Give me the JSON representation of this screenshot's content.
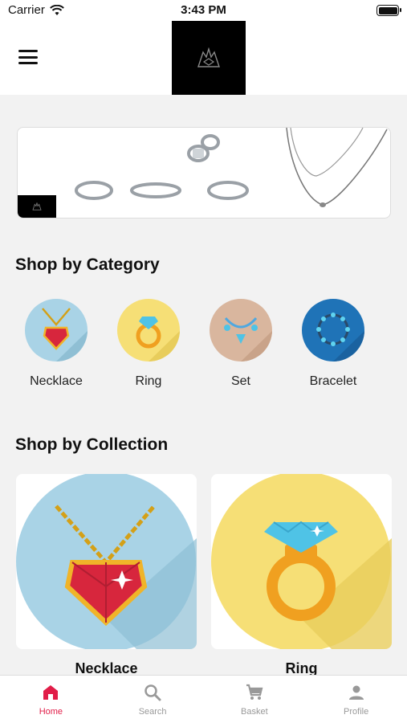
{
  "status": {
    "carrier": "Carrier",
    "time": "3:43 PM"
  },
  "sections": {
    "category_title": "Shop by Category",
    "collection_title": "Shop by Collection"
  },
  "categories": [
    {
      "label": "Necklace",
      "bg": "#a9d3e6"
    },
    {
      "label": "Ring",
      "bg": "#f6df76"
    },
    {
      "label": "Set",
      "bg": "#d9b69e"
    },
    {
      "label": "Bracelet",
      "bg": "#1f73b7"
    }
  ],
  "collections": [
    {
      "label": "Necklace"
    },
    {
      "label": "Ring"
    }
  ],
  "tabs": [
    {
      "label": "Home",
      "icon": "home-icon",
      "active": true
    },
    {
      "label": "Search",
      "icon": "search-icon"
    },
    {
      "label": "Basket",
      "icon": "cart-icon"
    },
    {
      "label": "Profile",
      "icon": "person-icon"
    }
  ],
  "colors": {
    "accent": "#e11d48",
    "inactive": "#999999"
  }
}
